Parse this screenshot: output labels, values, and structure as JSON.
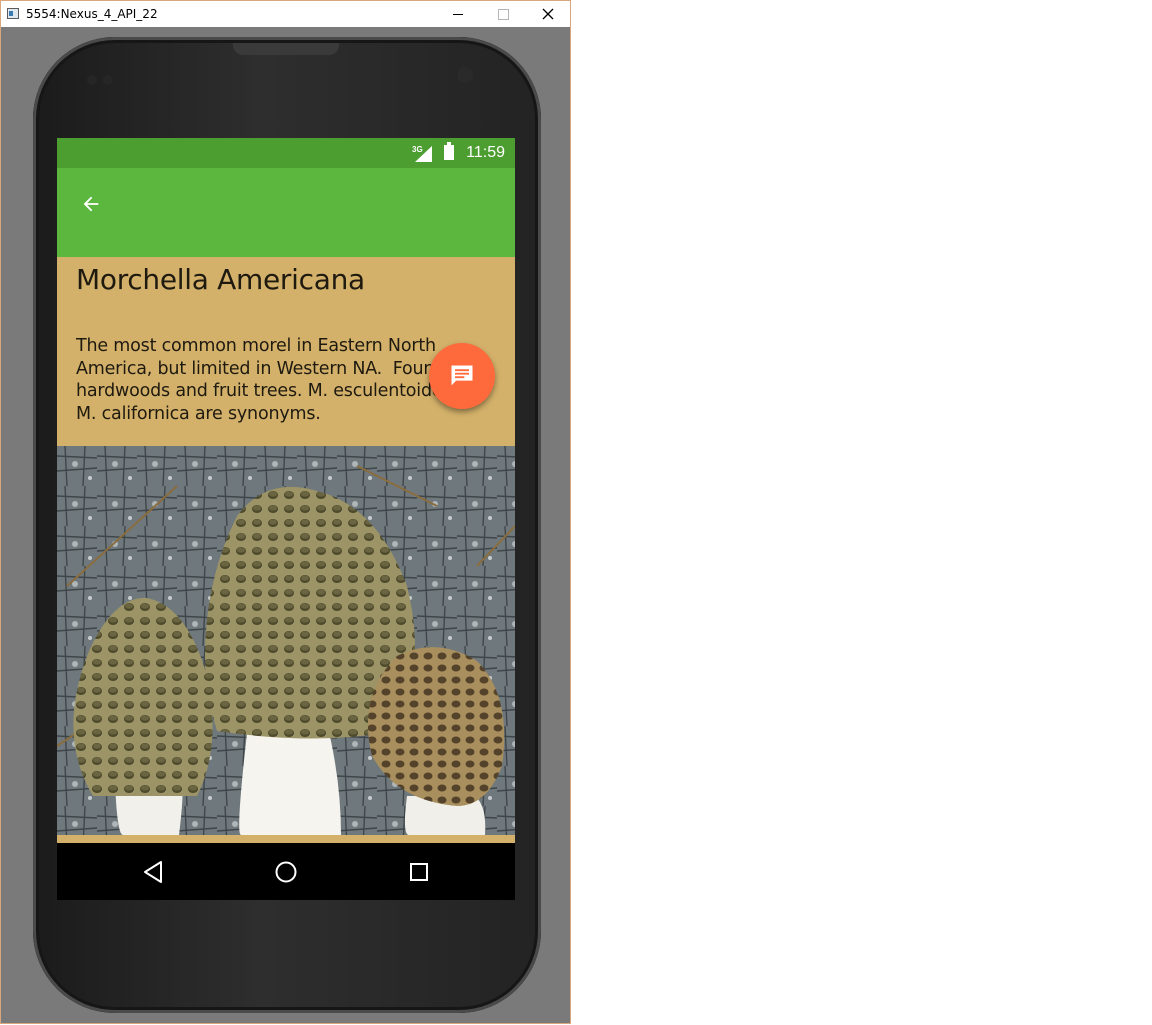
{
  "window": {
    "title": "5554:Nexus_4_API_22"
  },
  "status_bar": {
    "network": "3G",
    "time": "11:59"
  },
  "app_bar": {
    "back_icon": "arrow-back-icon",
    "color": "#5cb73e"
  },
  "detail": {
    "title": "Morchella Americana",
    "description": "The most common morel in Eastern North America, but limited in Western NA.  Found with hardwoods and fruit trees. M. esculentoides and M. californica are synonyms.",
    "card_color": "#d3b16a"
  },
  "fab": {
    "icon": "message-icon",
    "color": "#ff6a3d"
  },
  "nav_bar": {
    "buttons": [
      "back-triangle-icon",
      "home-circle-icon",
      "recents-square-icon"
    ]
  }
}
